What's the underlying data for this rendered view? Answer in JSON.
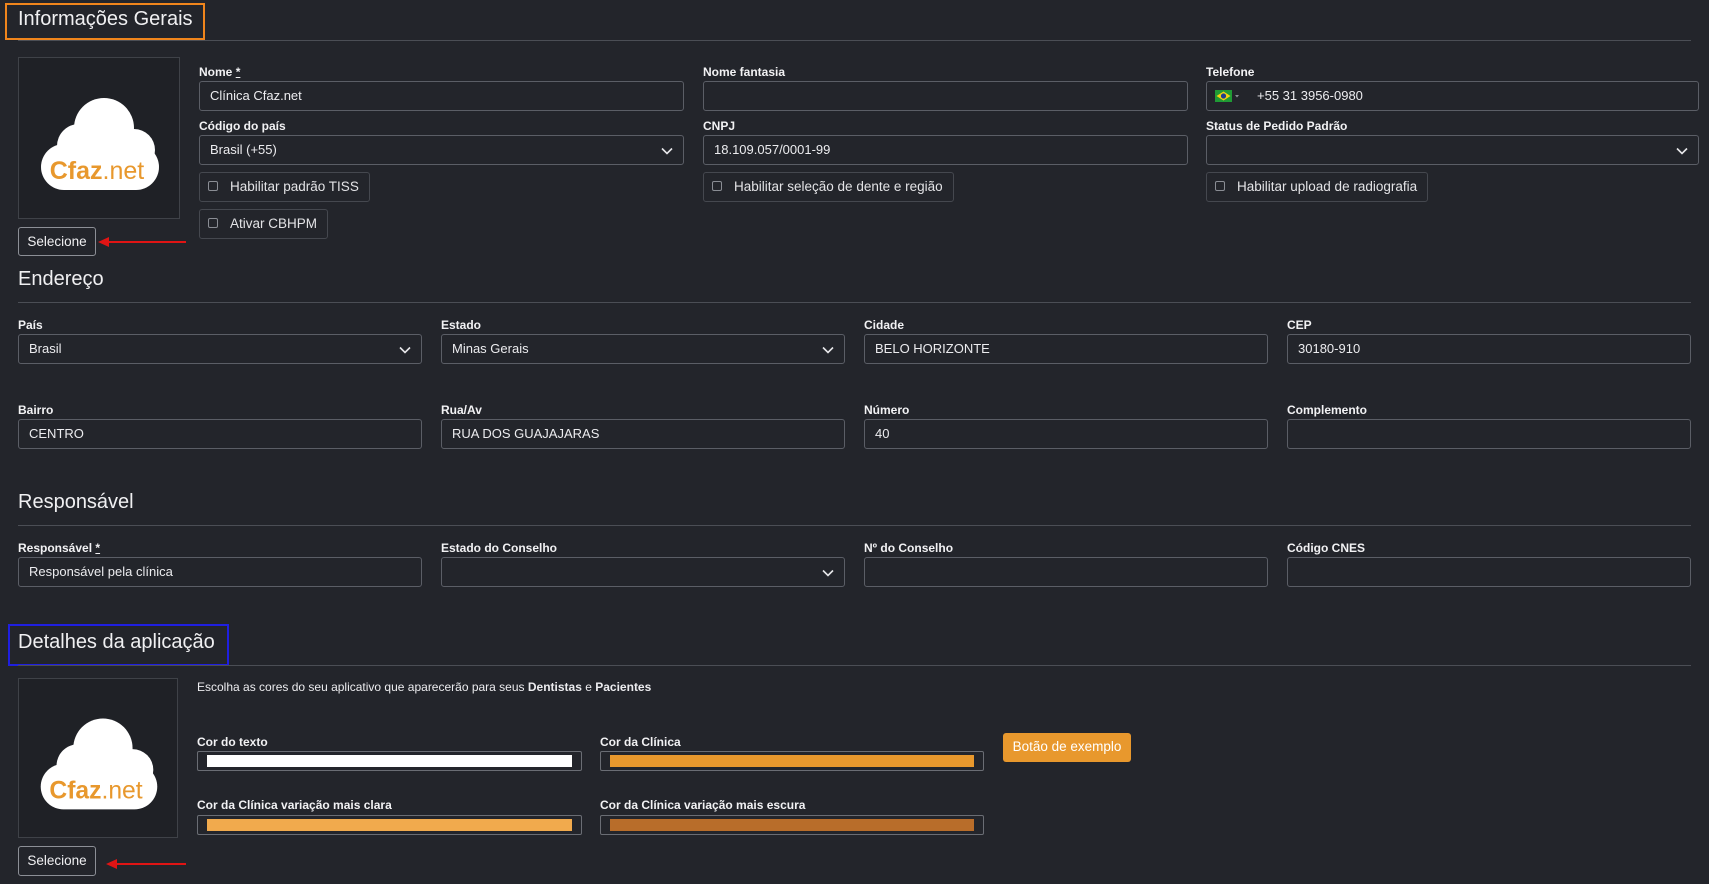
{
  "general": {
    "title": "Informações Gerais",
    "logo_text_a": "Cfaz",
    "logo_text_b": ".net",
    "select_button": "Selecione",
    "nome_label": "Nome",
    "nome_req": "*",
    "nome_value": "Clínica Cfaz.net",
    "fantasia_label": "Nome fantasia",
    "fantasia_value": "",
    "telefone_label": "Telefone",
    "telefone_value": "+55 31 3956-0980",
    "pais_codigo_label": "Código do país",
    "pais_codigo_value": "Brasil (+55)",
    "cnpj_label": "CNPJ",
    "cnpj_value": "18.109.057/0001-99",
    "status_label": "Status de Pedido Padrão",
    "status_value": "",
    "chk_tiss": "Habilitar padrão TISS",
    "chk_dente": "Habilitar seleção de dente e região",
    "chk_radiografia": "Habilitar upload de radiografia",
    "chk_cbhpm": "Ativar CBHPM"
  },
  "address": {
    "title": "Endereço",
    "pais_label": "País",
    "pais_value": "Brasil",
    "estado_label": "Estado",
    "estado_value": "Minas Gerais",
    "cidade_label": "Cidade",
    "cidade_value": "BELO HORIZONTE",
    "cep_label": "CEP",
    "cep_value": "30180-910",
    "bairro_label": "Bairro",
    "bairro_value": "CENTRO",
    "rua_label": "Rua/Av",
    "rua_value": "RUA DOS GUAJAJARAS",
    "numero_label": "Número",
    "numero_value": "40",
    "complemento_label": "Complemento",
    "complemento_value": ""
  },
  "responsible": {
    "title": "Responsável",
    "resp_label": "Responsável",
    "resp_req": "*",
    "resp_value": "Responsável pela clínica",
    "estado_conselho_label": "Estado do Conselho",
    "estado_conselho_value": "",
    "num_conselho_label": "Nº do Conselho",
    "num_conselho_value": "",
    "cnes_label": "Código CNES",
    "cnes_value": ""
  },
  "app": {
    "title": "Detalhes da aplicação",
    "intro_a": "Escolha as cores do seu aplicativo que aparecerão para seus ",
    "intro_b": "Dentistas",
    "intro_c": " e ",
    "intro_d": "Pacientes",
    "cor_texto_label": "Cor do texto",
    "cor_clinica_label": "Cor da Clínica",
    "cor_clara_label": "Cor da Clínica variação mais clara",
    "cor_escura_label": "Cor da Clínica variação mais escura",
    "example_button": "Botão de exemplo",
    "select_button": "Selecione"
  },
  "colors": {
    "text_color": "#ffffff",
    "clinic_color": "#e8982d",
    "light_color": "#f1aa4d",
    "dark_color": "#b86d2a",
    "highlight_orange": "#f0851c",
    "highlight_blue": "#1f1fe0",
    "arrow_red": "#e01414"
  },
  "icons": {
    "select_chevron": "chevron-down-icon",
    "flag": "brazil-flag-icon",
    "arrow": "red-arrow-icon",
    "logo": "cfaz-cloud-logo"
  }
}
